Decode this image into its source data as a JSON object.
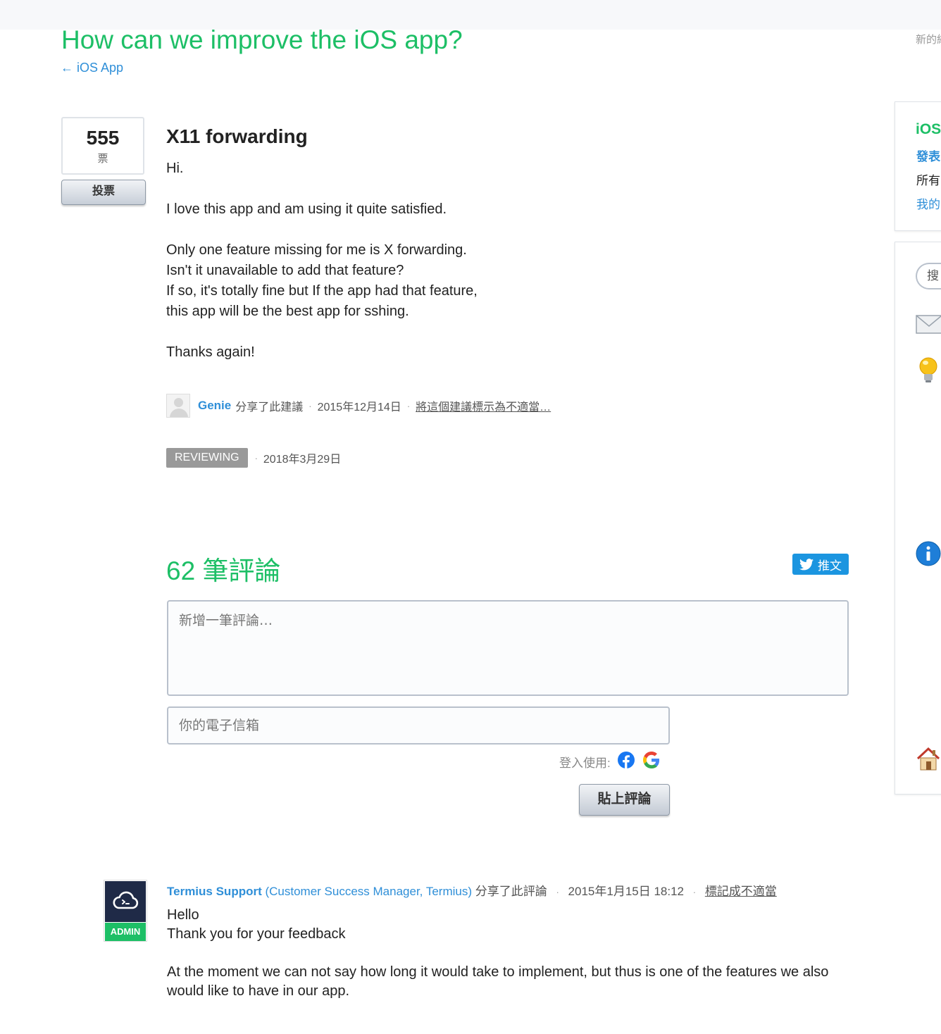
{
  "header": {
    "title": "How can we improve the iOS app?",
    "back_link": "← iOS App",
    "top_right_text": "新的網"
  },
  "idea": {
    "votes": "555",
    "votes_unit": "票",
    "vote_button": "投票",
    "title": "X11 forwarding",
    "body": [
      "Hi.",
      "",
      "I love this app and am using it quite satisfied.",
      "",
      "Only one feature missing for me is X forwarding.",
      "Isn't it unavailable to add that feature?",
      "If so, it's totally fine but If the app had that feature,",
      "this app will be the best app for sshing.",
      "",
      "Thanks again!"
    ],
    "author": "Genie",
    "shared_text": "分享了此建議",
    "date": "2015年12月14日",
    "flag_link": "將這個建議標示為不適當…",
    "status": "REVIEWING",
    "status_date": "2018年3月29日"
  },
  "comments": {
    "title": "62 筆評論",
    "tweet_label": "推文",
    "comment_placeholder": "新增一筆評論…",
    "email_placeholder": "你的電子信箱",
    "login_label": "登入使用:",
    "post_button": "貼上評論"
  },
  "admin_comment": {
    "badge": "ADMIN",
    "author": "Termius Support",
    "role": "(Customer Success Manager, Termius)",
    "shared_text": "分享了此評論",
    "date": "2015年1月15日 18:12",
    "flag_link": "標記成不適當",
    "body": [
      "Hello",
      "Thank you for your feedback",
      "",
      "At the moment we can not say how long it would take to implement, but thus is one of the features we also would like to have in our app."
    ]
  },
  "sidebar": {
    "title": "iOS",
    "links": [
      "發表",
      "所有",
      "我的"
    ],
    "search_placeholder": "搜"
  },
  "colors": {
    "accent_green": "#1dbf66",
    "link_blue": "#2f8fd8",
    "twitter_blue": "#1b95e0",
    "status_gray": "#999999"
  }
}
